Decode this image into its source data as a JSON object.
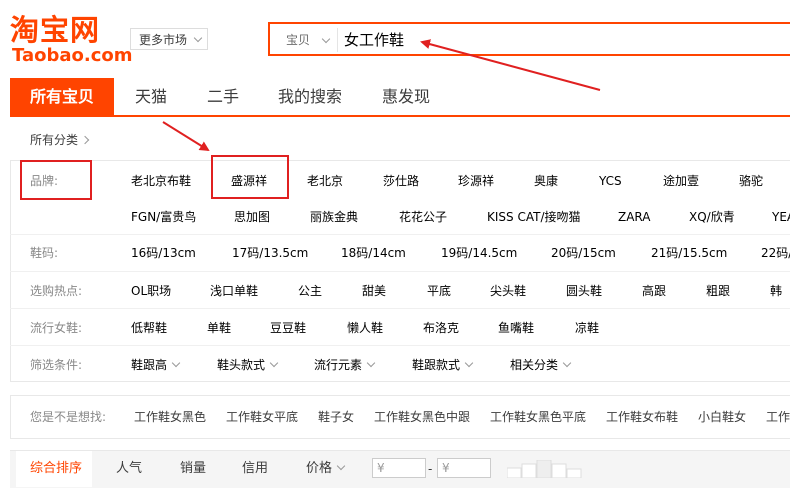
{
  "logo": {
    "cn": "淘宝网",
    "en": "Taobao.com"
  },
  "header": {
    "more_market": "更多市场"
  },
  "search": {
    "category": "宝贝",
    "query": "女工作鞋"
  },
  "tabs": [
    "所有宝贝",
    "天猫",
    "二手",
    "我的搜索",
    "惠发现"
  ],
  "breadcrumb": "所有分类",
  "filters": {
    "brand_label": "品牌:",
    "brands_row1": [
      "老北京布鞋",
      "盛源祥",
      "老北京",
      "莎仕路",
      "珍源祥",
      "奥康",
      "YCS",
      "途加壹",
      "骆驼"
    ],
    "brands_row2": [
      "FGN/富贵鸟",
      "思加图",
      "丽族金典",
      "花花公子",
      "KISS CAT/接吻猫",
      "ZARA",
      "XQ/欣青",
      "YEA"
    ],
    "size_label": "鞋码:",
    "sizes": [
      "16码/13cm",
      "17码/13.5cm",
      "18码/14cm",
      "19码/14.5cm",
      "20码/15cm",
      "21码/15.5cm",
      "22码/"
    ],
    "hot_label": "选购热点:",
    "hot": [
      "OL职场",
      "浅口单鞋",
      "公主",
      "甜美",
      "平底",
      "尖头鞋",
      "圆头鞋",
      "高跟",
      "粗跟",
      "韩"
    ],
    "style_label": "流行女鞋:",
    "styles": [
      "低帮鞋",
      "单鞋",
      "豆豆鞋",
      "懒人鞋",
      "布洛克",
      "鱼嘴鞋",
      "凉鞋"
    ],
    "cond_label": "筛选条件:",
    "conditions": [
      "鞋跟高",
      "鞋头款式",
      "流行元素",
      "鞋跟款式",
      "相关分类"
    ]
  },
  "suggestions": {
    "label": "您是不是想找:",
    "items": [
      "工作鞋女黑色",
      "工作鞋女平底",
      "鞋子女",
      "工作鞋女黑色中跟",
      "工作鞋女黑色平底",
      "工作鞋女布鞋",
      "小白鞋女",
      "工作"
    ]
  },
  "sort": {
    "items": [
      "综合排序",
      "人气",
      "销量",
      "信用",
      "价格"
    ],
    "price_min_placeholder": "¥",
    "price_max_placeholder": "¥",
    "price_sep": "-"
  },
  "colors": {
    "accent": "#ff4400",
    "annotation": "#e02020"
  }
}
